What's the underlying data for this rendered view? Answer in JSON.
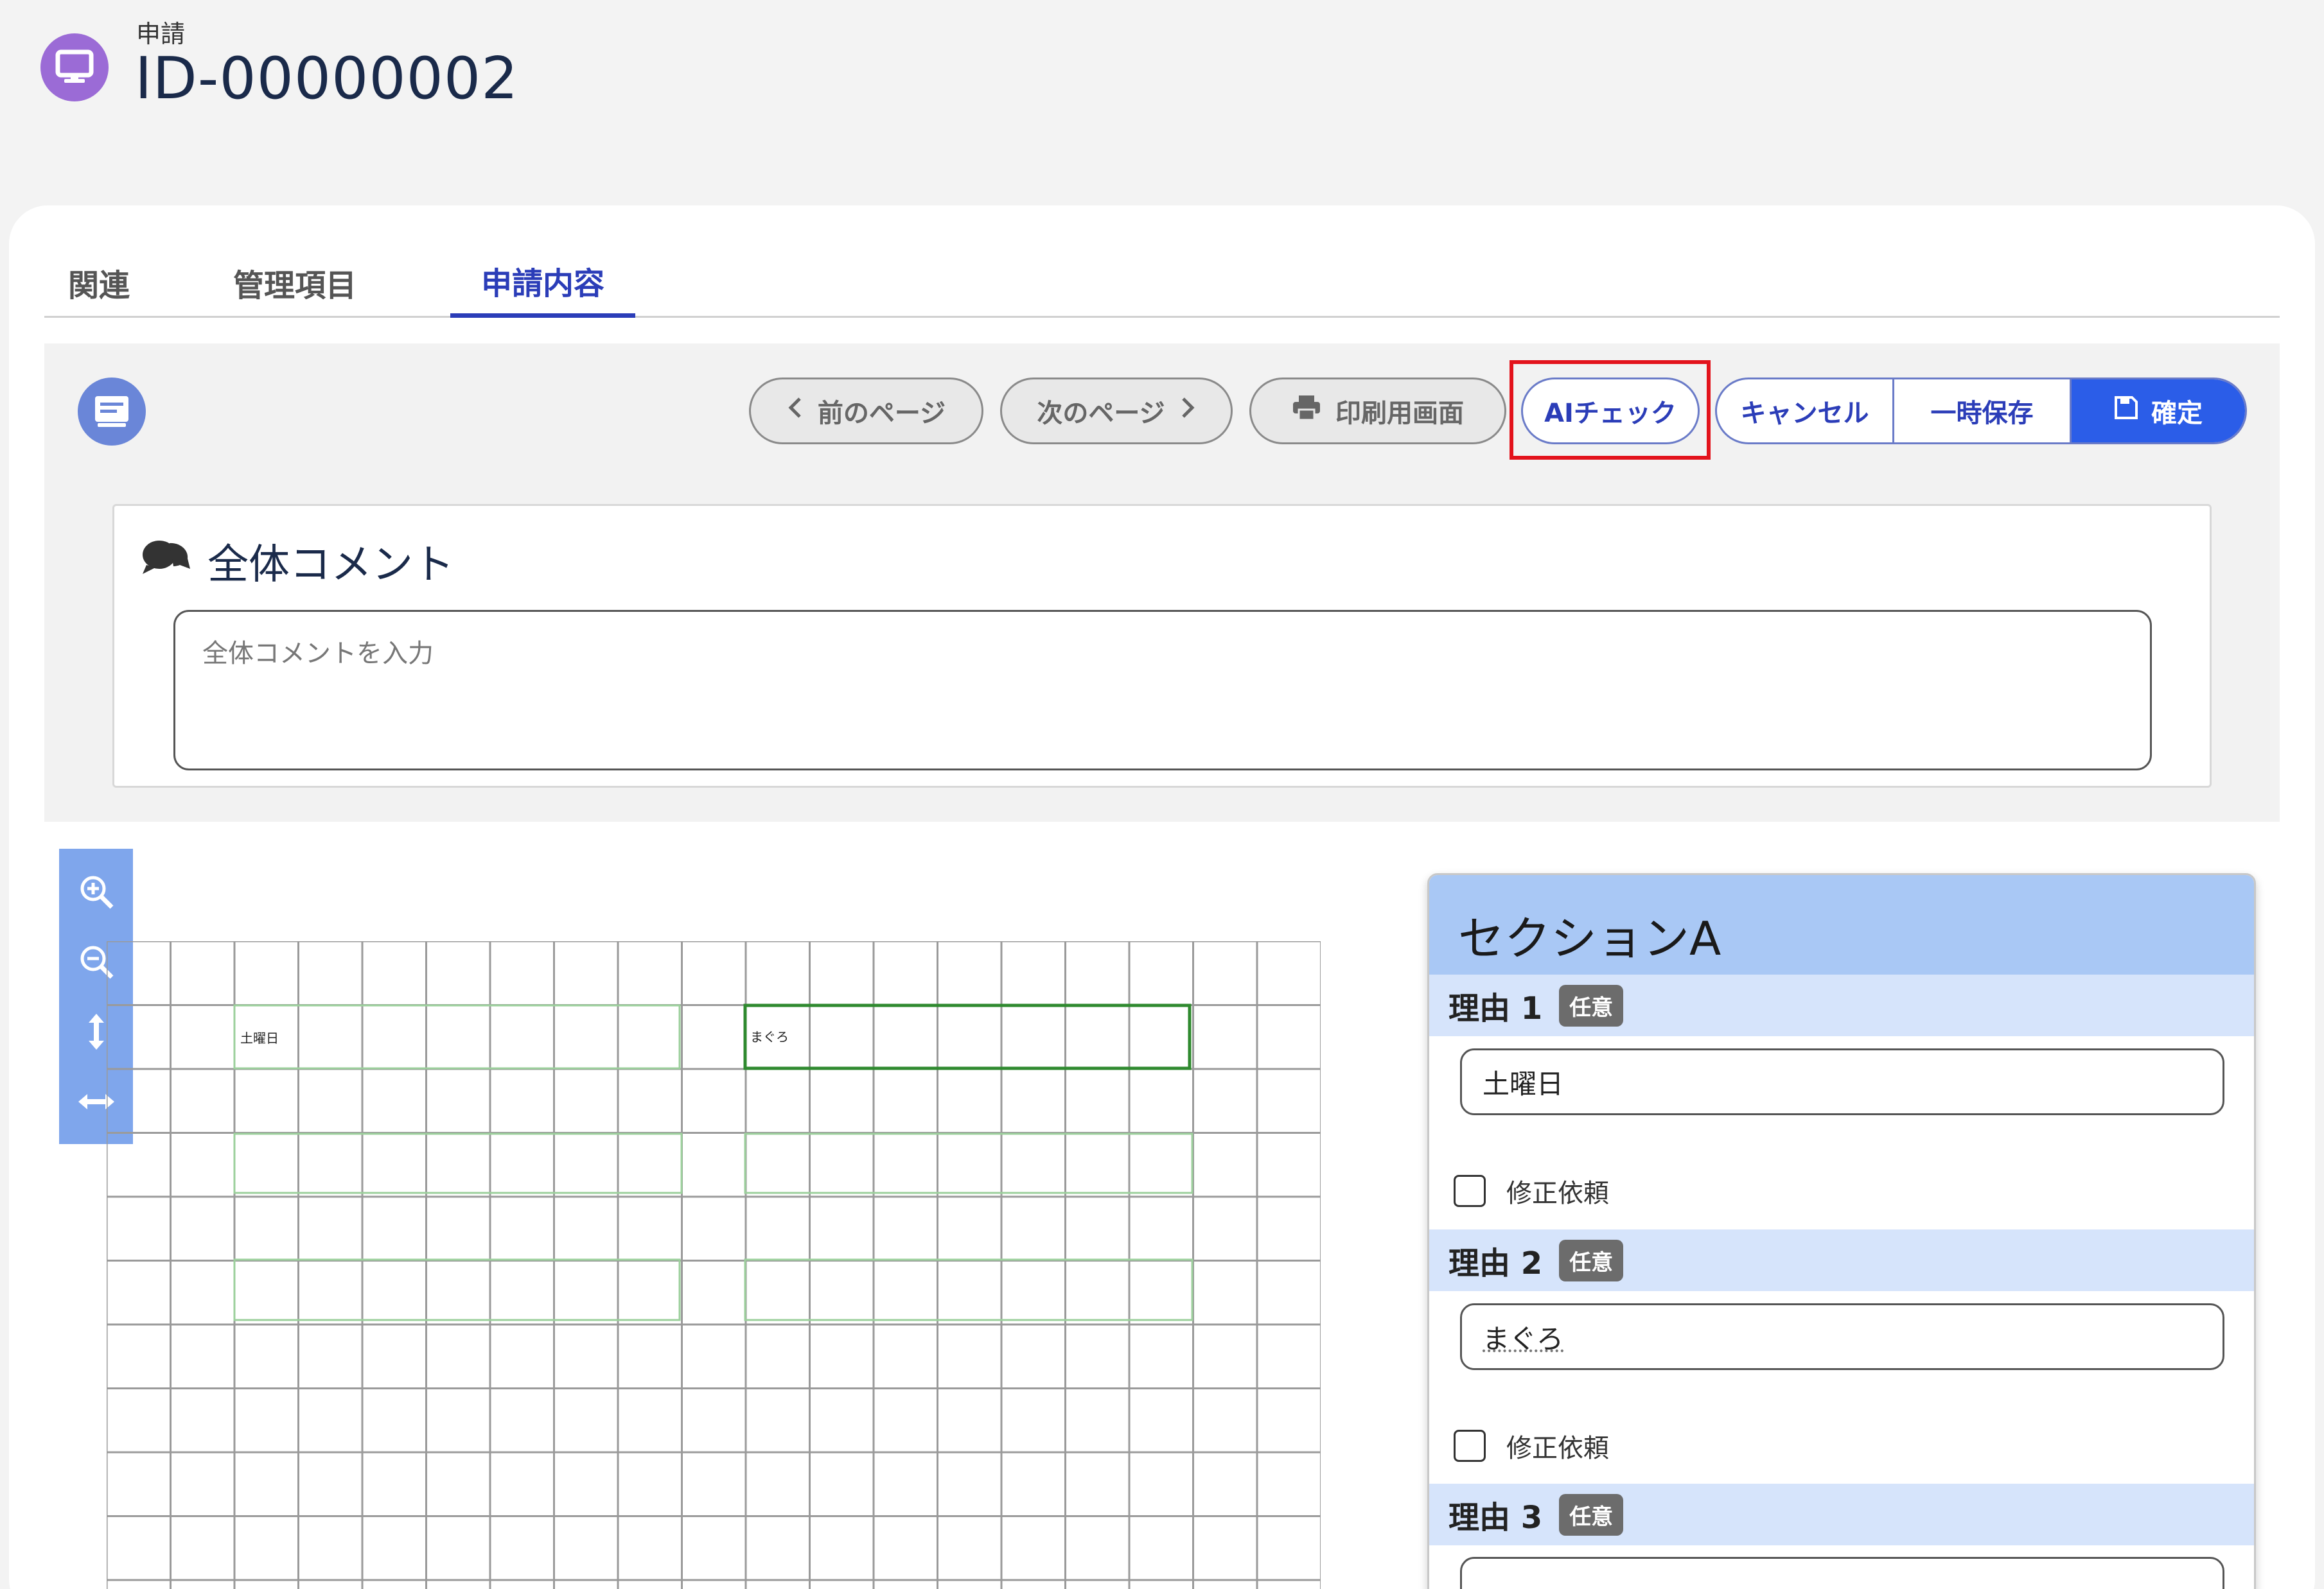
{
  "header": {
    "category": "申請",
    "title": "ID-00000002"
  },
  "tabs": [
    {
      "label": "関連"
    },
    {
      "label": "管理項目"
    },
    {
      "label": "申請内容"
    }
  ],
  "toolbar": {
    "prev_label": "前のページ",
    "next_label": "次のページ",
    "print_label": "印刷用画面",
    "ai_check_label": "AIチェック",
    "cancel_label": "キャンセル",
    "temp_save_label": "一時保存",
    "confirm_label": "確定"
  },
  "comment": {
    "title": "全体コメント",
    "placeholder": "全体コメントを入力"
  },
  "document": {
    "cell_text_1": "土曜日",
    "cell_text_2": "まぐろ"
  },
  "section": {
    "title": "セクションA",
    "fields": [
      {
        "label": "理由 1",
        "badge": "任意",
        "value": "土曜日",
        "checkbox_label": "修正依頼"
      },
      {
        "label": "理由 2",
        "badge": "任意",
        "value": "まぐろ",
        "checkbox_label": "修正依頼"
      },
      {
        "label": "理由 3",
        "badge": "任意",
        "value": ""
      }
    ]
  },
  "colors": {
    "accent": "#2b3db8",
    "primary_button": "#2b5de8",
    "highlight_frame": "#e3131c",
    "section_header": "#a9c8f5",
    "field_header": "#d6e4fb",
    "header_icon": "#9b6bd6"
  },
  "icons": {
    "header": "monitor-icon",
    "toolbar": "document-icon",
    "comment": "speech-bubbles-icon",
    "zoom": [
      "zoom-in-icon",
      "zoom-out-icon",
      "fit-height-icon",
      "fit-width-icon"
    ]
  }
}
